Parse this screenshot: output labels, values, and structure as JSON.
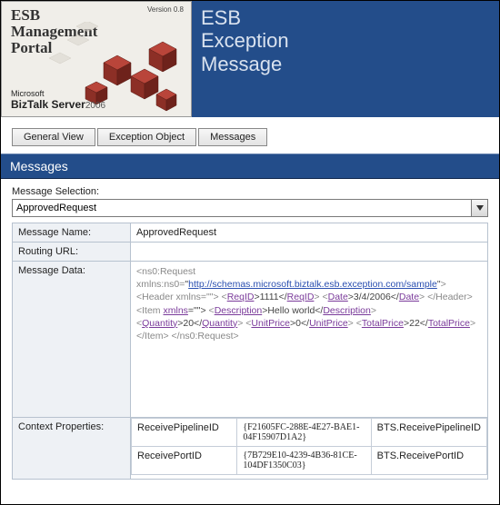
{
  "header": {
    "logo_line1": "ESB",
    "logo_line2": "Management",
    "logo_line3": "Portal",
    "version": "Version 0.8",
    "biztalk_small": "Microsoft",
    "biztalk_brand": "BizTalk Server",
    "biztalk_year": "2006",
    "page_title_line1": "ESB",
    "page_title_line2": "Exception",
    "page_title_line3": "Message"
  },
  "tabs": [
    {
      "label": "General View"
    },
    {
      "label": "Exception Object"
    },
    {
      "label": "Messages"
    }
  ],
  "band_title": "Messages",
  "selection": {
    "label": "Message Selection:",
    "value": "ApprovedRequest"
  },
  "rows": {
    "message_name": {
      "label": "Message Name:",
      "value": "ApprovedRequest"
    },
    "routing_url": {
      "label": "Routing URL:",
      "value": ""
    },
    "message_data_label": "Message Data:",
    "context_props_label": "Context Properties:"
  },
  "message_data": {
    "root_open": "<ns0:Request",
    "xmlns": "xmlns:ns0=",
    "ns_url": "http://schemas.microsoft.biztalk.esb.exception.com/sample",
    "header_open": "> <Header xmlns=\"\"> <",
    "reqid_open": "ReqID",
    "reqid_val": ">1111</",
    "reqid_close": "ReqID",
    "date_open": "> <",
    "date_tag": "Date",
    "date_val": ">3/4/2006</",
    "date_tag2": "Date",
    "after_date": "> </Header> <Item ",
    "item_xmlns": "xmlns",
    "item_xmlns_val": "=\"\">",
    "desc_open": "<",
    "desc_tag": "Description",
    "desc_val": ">Hello world</",
    "desc_tag2": "Description",
    "qty_open": "> <",
    "qty_tag": "Quantity",
    "qty_val": ">20</",
    "qty_tag2": "Quantity",
    "unit_open": "> <",
    "unit_tag": "UnitPrice",
    "unit_val": ">0</",
    "unit_tag2": "UnitPrice",
    "total_open": "> <",
    "total_tag": "TotalPrice",
    "total_val": ">22</",
    "total_tag2": "TotalPrice",
    "tail": "> </Item> </ns0:Request>"
  },
  "context_properties": [
    {
      "name": "ReceivePipelineID",
      "guid": "{F21605FC-288E-4E27-BAE1-04F15907D1A2}",
      "bts": "BTS.ReceivePipelineID"
    },
    {
      "name": "ReceivePortID",
      "guid": "{7B729E10-4239-4B36-81CE-104DF1350C03}",
      "bts": "BTS.ReceivePortID"
    }
  ]
}
